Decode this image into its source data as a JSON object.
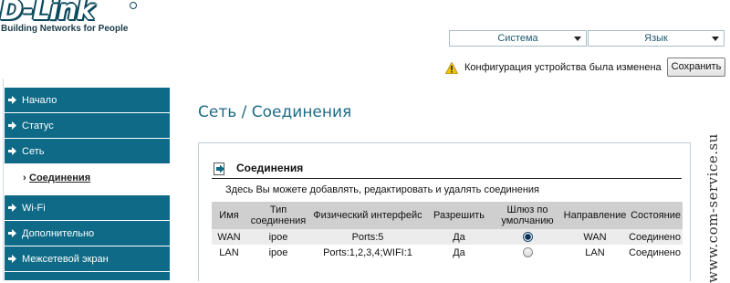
{
  "header": {
    "logo_text": "D-Link",
    "tagline": "Building Networks for People",
    "system_menu": "Система",
    "language_menu": "Язык",
    "notice": "Конфигурация устройства была изменена",
    "save_label": "Сохранить"
  },
  "sidebar": {
    "items": [
      {
        "label": "Начало"
      },
      {
        "label": "Статус"
      },
      {
        "label": "Сеть"
      },
      {
        "label": "Соединения",
        "selected": true
      },
      {
        "label": "Wi-Fi"
      },
      {
        "label": "Дополнительно"
      },
      {
        "label": "Межсетевой экран"
      }
    ]
  },
  "main": {
    "title": "Сеть  /  Соединения",
    "panel_title": "Соединения",
    "description": "Здесь Вы можете добавлять, редактировать и удалять соединения",
    "table": {
      "headers": [
        "Имя",
        "Тип соединения",
        "Физический интерфейс",
        "Разрешить",
        "Шлюз по умолчанию",
        "Направление",
        "Состояние"
      ],
      "rows": [
        {
          "name": "WAN",
          "type": "ipoe",
          "iface": "Ports:5",
          "enable": "Да",
          "default_gw": true,
          "direction": "WAN",
          "state": "Соединено"
        },
        {
          "name": "LAN",
          "type": "ipoe",
          "iface": "Ports:1,2,3,4;WIFI:1",
          "enable": "Да",
          "default_gw": false,
          "direction": "LAN",
          "state": "Соединено"
        }
      ]
    }
  },
  "watermark": "www.com-service.su",
  "colors": {
    "nav_bg": "#0e6a87",
    "title": "#1e6b86",
    "table_header_bg": "#cfcfcf",
    "row_alt_bg": "#ececec"
  },
  "icons": [
    "warning-icon",
    "chevron-down-icon",
    "arrow-right-icon",
    "panel-arrow-icon",
    "radio-icon"
  ]
}
